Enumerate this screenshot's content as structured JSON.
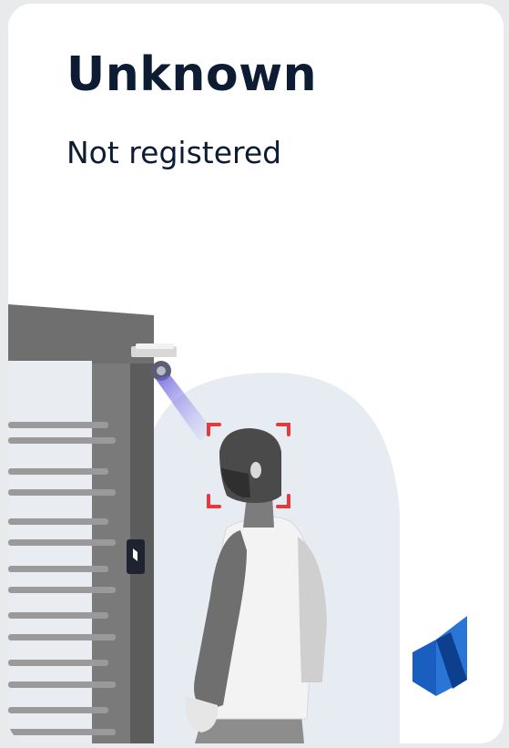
{
  "status": {
    "title": "Unknown",
    "subtitle": "Not registered"
  },
  "illustration": {
    "scene": "turnstile-face-recognition",
    "highlight_color": "#e8393a",
    "camera_beam_color": "#6b5bd6",
    "brand_logo": "blue-n-logo",
    "brand_color": "#1a5fbf"
  }
}
